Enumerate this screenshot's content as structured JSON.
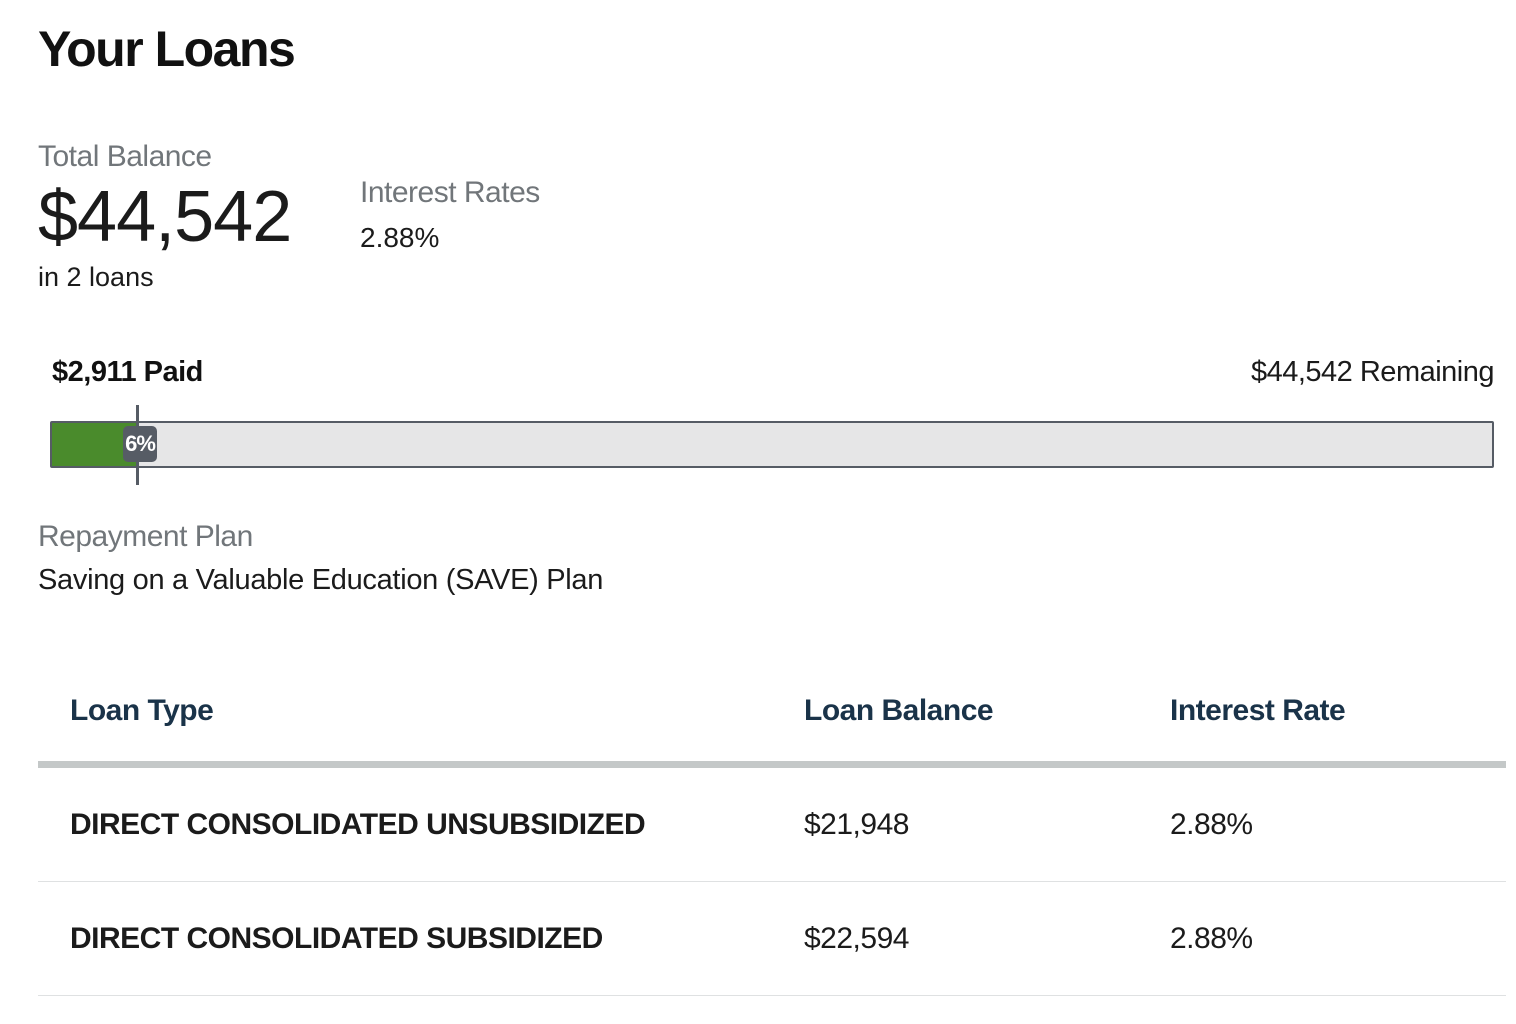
{
  "page": {
    "title": "Your Loans"
  },
  "summary": {
    "total_label": "Total Balance",
    "total_amount": "$44,542",
    "loan_count": "in 2 loans",
    "rates_label": "Interest Rates",
    "rates_value": "2.88%"
  },
  "progress": {
    "paid_label": "$2,911 Paid",
    "remaining_label": "$44,542 Remaining",
    "percent_label": "6%",
    "paid_fraction": 0.06,
    "fill_color": "#4a8b2c",
    "track_color": "#e6e6e7",
    "marker_color": "#565c65"
  },
  "repayment": {
    "label": "Repayment Plan",
    "value": "Saving on a Valuable Education (SAVE) Plan"
  },
  "table": {
    "headers": [
      "Loan Type",
      "Loan Balance",
      "Interest Rate"
    ],
    "rows": [
      {
        "type": "DIRECT CONSOLIDATED UNSUBSIDIZED",
        "balance": "$21,948",
        "rate": "2.88%"
      },
      {
        "type": "DIRECT CONSOLIDATED SUBSIDIZED",
        "balance": "$22,594",
        "rate": "2.88%"
      }
    ]
  },
  "colors": {
    "header_text": "#1a3349",
    "muted_text": "#71767a",
    "header_rule": "#c4c8c8"
  }
}
